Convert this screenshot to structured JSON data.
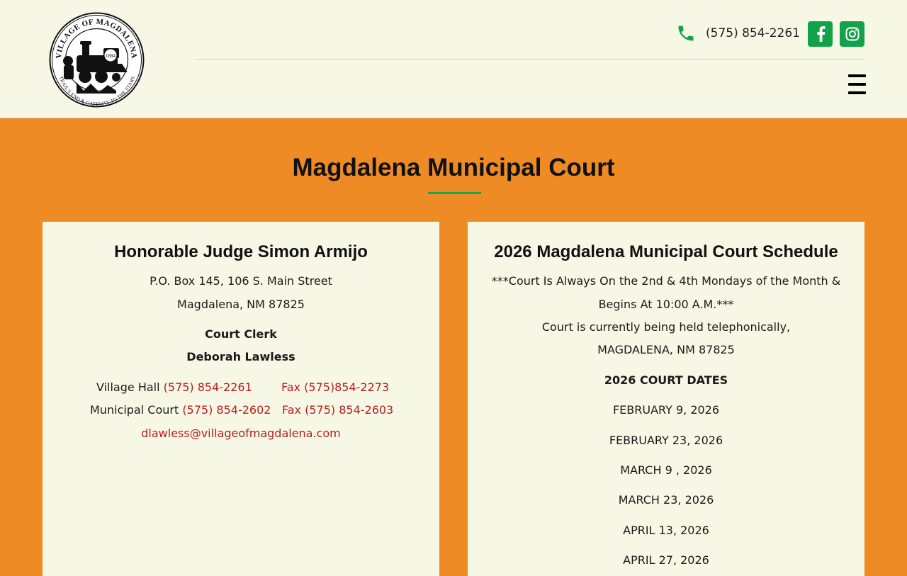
{
  "header": {
    "logo": {
      "ring_top": "VILLAGE OF MAGDALENA",
      "ring_bottom": "TRAIL'S END & GATEWAY TO THE STARS",
      "year": "1884"
    },
    "phone": "(575) 854-2261",
    "social": [
      "facebook",
      "instagram"
    ]
  },
  "colors": {
    "accent_orange": "#ee8b24",
    "brand_green": "#12a24a",
    "link_red": "#b81c1c",
    "panel_bg": "#f6f8e5"
  },
  "page": {
    "title": "Magdalena Municipal Court"
  },
  "judge_card": {
    "heading": "Honorable Judge Simon Armijo",
    "address_1": "P.O. Box 145, 106 S. Main Street",
    "address_2": "Magdalena, NM 87825",
    "clerk_title": "Court Clerk",
    "clerk_name": "Deborah Lawless",
    "contacts": [
      {
        "label": "Village Hall",
        "phone": "(575) 854-2261",
        "fax": "Fax (575)854-2273"
      },
      {
        "label": "Municipal Court",
        "phone": "(575) 854-2602",
        "fax": "Fax (575) 854-2603"
      }
    ],
    "email": "dlawless@villageofmagdalena.com"
  },
  "schedule_card": {
    "heading": "2026 Magdalena Municipal Court Schedule",
    "note_1": "***Court Is Always On the 2nd & 4th Mondays of the Month &",
    "note_2": "Begins At 10:00 A.M.***",
    "note_3": "Court is currently being held telephonically,",
    "note_4": "MAGDALENA, NM 87825",
    "dates_heading": "2026 COURT DATES",
    "dates": [
      "FEBRUARY 9, 2026",
      "FEBRUARY 23, 2026",
      "MARCH 9 , 2026",
      "MARCH 23, 2026",
      "APRIL 13, 2026",
      "APRIL 27, 2026"
    ]
  }
}
